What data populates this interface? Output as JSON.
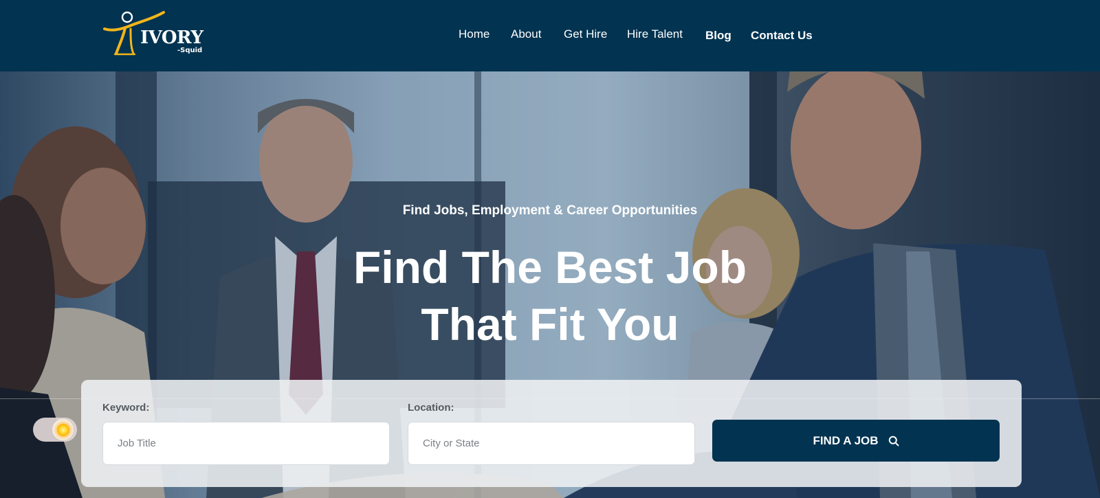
{
  "brand": {
    "name": "IVORY",
    "sub": "-Squid",
    "colors": {
      "navy": "#023351",
      "gold": "#f2b61a",
      "white": "#ffffff"
    }
  },
  "nav": {
    "items": [
      {
        "label": "Home"
      },
      {
        "label": "About"
      },
      {
        "label": "Get Hire"
      },
      {
        "label": "Hire Talent"
      },
      {
        "label": "Blog"
      },
      {
        "label": "Contact Us"
      }
    ]
  },
  "hero": {
    "subtitle": "Find Jobs, Employment & Career Opportunities",
    "title_line1": "Find The Best Job",
    "title_line2": "That Fit You"
  },
  "search": {
    "keyword_label": "Keyword:",
    "keyword_placeholder": "Job Title",
    "keyword_value": "",
    "location_label": "Location:",
    "location_placeholder": "City or State",
    "location_value": "",
    "button_label": "FIND A JOB",
    "button_icon": "search-icon"
  },
  "theme_toggle": {
    "icon": "sun-icon",
    "state": "light"
  }
}
